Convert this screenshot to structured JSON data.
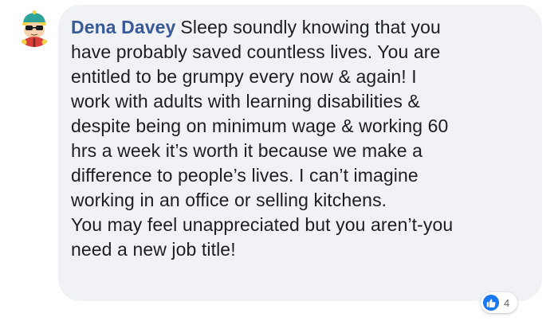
{
  "comment": {
    "author": "Dena Davey",
    "lines": [
      "Sleep soundly knowing that you",
      "have probably saved countless lives. You are",
      "entitled to be grumpy every now & again! I",
      "work with adults with learning disabilities &",
      "despite being on minimum wage & working 60",
      "hrs a week it’s worth it because we make a",
      "difference to people’s lives. I can’t imagine",
      "working in an office or selling kitchens.",
      "You may feel unappreciated but you aren’t-you",
      "need a new job title!"
    ],
    "reactions": {
      "icon": "like-icon",
      "count": "4"
    }
  },
  "avatar": {
    "icon": "cartoon-character-avatar"
  },
  "colors": {
    "author_name": "#385898",
    "bubble_bg": "#f0f2f5",
    "text": "#1c1e21",
    "like_blue": "#1877f2"
  }
}
